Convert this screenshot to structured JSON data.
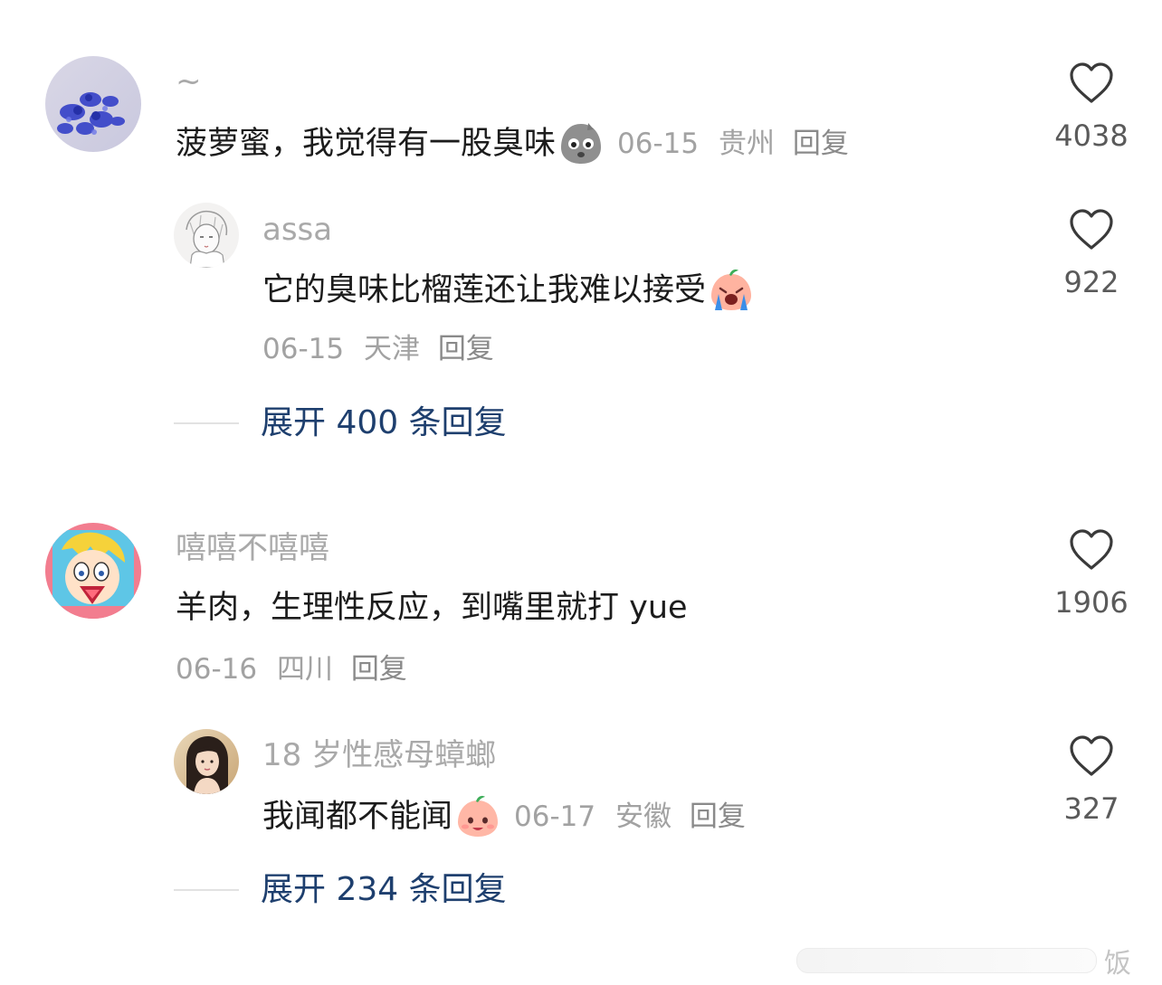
{
  "comments": [
    {
      "username": "~",
      "text": "菠萝蜜，我觉得有一股臭味",
      "emoji": "stinky-face-emoji",
      "date": "06-15",
      "location": "贵州",
      "reply_label": "回复",
      "likes": "4038",
      "replies": [
        {
          "username": "assa",
          "text": "它的臭味比榴莲还让我难以接受",
          "emoji": "crying-peach-emoji",
          "date": "06-15",
          "location": "天津",
          "reply_label": "回复",
          "likes": "922"
        }
      ],
      "expand_label": "展开 400 条回复"
    },
    {
      "username": "嘻嘻不嘻嘻",
      "text": "羊肉，生理性反应，到嘴里就打 yue",
      "date": "06-16",
      "location": "四川",
      "reply_label": "回复",
      "likes": "1906",
      "replies": [
        {
          "username": "18 岁性感母蟑螂",
          "text": "我闻都不能闻",
          "emoji": "smiling-peach-emoji",
          "date": "06-17",
          "location": "安徽",
          "reply_label": "回复",
          "likes": "327"
        }
      ],
      "expand_label": "展开 234 条回复"
    }
  ],
  "watermark": {
    "char": "饭"
  },
  "colors": {
    "link": "#1e3f6e",
    "meta": "#a2a2a2",
    "text": "#1c1c1c"
  }
}
